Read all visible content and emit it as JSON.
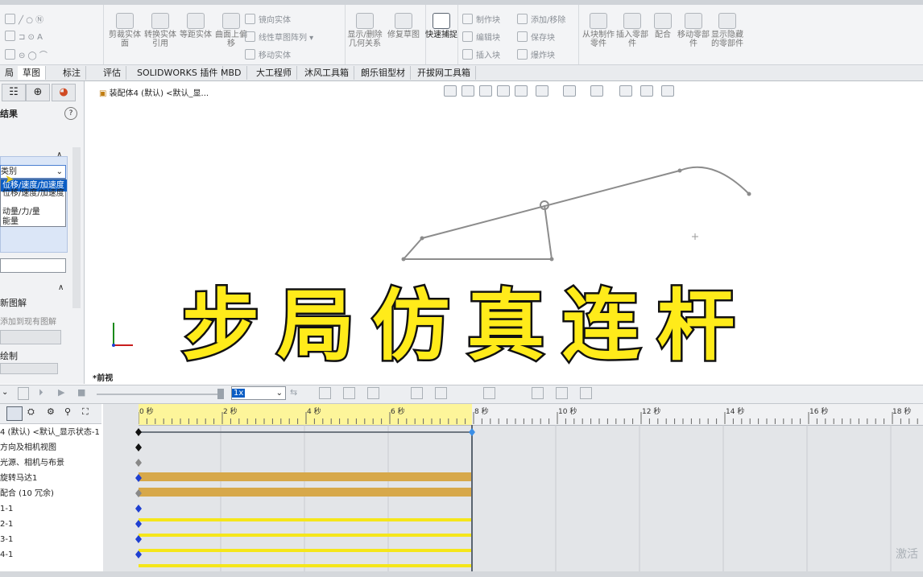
{
  "ribbon": {
    "groups": [
      {
        "items": [
          "剪裁实体面",
          "转换实体引用",
          "等距实体",
          "曲面上偏移"
        ]
      },
      {
        "items": [
          "镜向实体",
          "线性草图阵列",
          "移动实体"
        ]
      },
      {
        "items": [
          "显示/删除几何关系",
          "修复草图"
        ]
      },
      {
        "items": [
          "快速捕捉"
        ]
      },
      {
        "items": [
          "制作块",
          "编辑块",
          "插入块",
          "添加/移除",
          "保存块",
          "爆炸块"
        ]
      },
      {
        "items": [
          "从块制作零件",
          "插入零部件",
          "配合",
          "移动零部件",
          "显示隐藏的零部件"
        ]
      }
    ]
  },
  "tabs": [
    "局",
    "草图",
    "标注",
    "评估",
    "SOLIDWORKS 插件",
    "MBD",
    "大工程师",
    "沐风工具箱",
    "朗乐钼型材",
    "开拔网工具箱"
  ],
  "left_panel": {
    "title": "结果",
    "combo_value": "类别",
    "dropdown_items": [
      "位移/速度/加速度",
      "动量/力/量",
      "能量"
    ],
    "section2_title": "新图解",
    "section2_option": "添加到现有图解",
    "section3_title": "绘制"
  },
  "canvas": {
    "doc_title": "装配体4 (默认) <默认_显...",
    "view_label": "*前视"
  },
  "overlay_title": "步局仿真连杆",
  "motion": {
    "speed_value": "1x",
    "tree_rows": [
      "4 (默认) <默认_显示状态-1",
      "方向及相机视图",
      "光源、相机与布景",
      "旋转马达1",
      "配合 (10 冗余)",
      "1-1",
      "2-1",
      "3-1",
      "4-1"
    ],
    "ruler_labels": [
      "0 秒",
      "2 秒",
      "4 秒",
      "6 秒",
      "8 秒",
      "10 秒",
      "12 秒",
      "14 秒",
      "16 秒",
      "18 秒"
    ]
  },
  "watermark": "激活",
  "colors": {
    "accent": "#ffeb1a",
    "bar_motor": "#d7a84a",
    "bar_part": "#f5e61a",
    "key_diamond": "#1e3fd1"
  }
}
